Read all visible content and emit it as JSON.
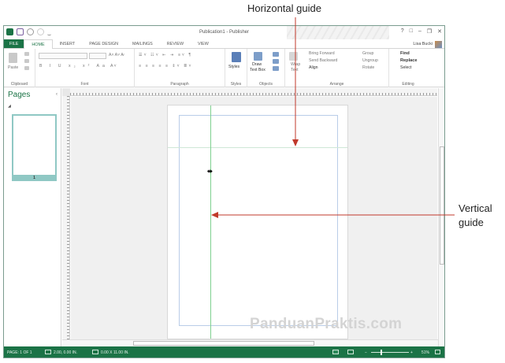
{
  "callouts": {
    "horizontal": "Horizontal guide",
    "vertical_line1": "Vertical",
    "vertical_line2": "guide"
  },
  "watermark": "PanduanPraktis.com",
  "titlebar": {
    "title": "Publication1 - Publisher",
    "help": "?",
    "restore": "□",
    "minimize": "–",
    "close": "✕"
  },
  "tabs": [
    "FILE",
    "HOME",
    "INSERT",
    "PAGE DESIGN",
    "MAILINGS",
    "REVIEW",
    "VIEW"
  ],
  "active_tab": "HOME",
  "user": {
    "name": "Lisa Bucki"
  },
  "ribbon": {
    "clipboard": {
      "label": "Clipboard",
      "paste": "Paste"
    },
    "font": {
      "label": "Font"
    },
    "paragraph": {
      "label": "Paragraph"
    },
    "styles": {
      "label": "Styles",
      "button": "Styles"
    },
    "objects": {
      "label": "Objects",
      "draw_text_box_1": "Draw",
      "draw_text_box_2": "Text Box"
    },
    "arrange": {
      "label": "Arrange",
      "wrap_text_1": "Wrap",
      "wrap_text_2": "Text",
      "bring_forward": "Bring Forward",
      "send_backward": "Send Backward",
      "align": "Align",
      "group": "Group",
      "ungroup": "Ungroup",
      "rotate": "Rotate"
    },
    "editing": {
      "label": "Editing",
      "find": "Find",
      "replace": "Replace",
      "select": "Select"
    }
  },
  "pages_panel": {
    "title": "Pages",
    "thumbnail_number": "1"
  },
  "status_bar": {
    "page": "PAGE: 1 OF 1",
    "position": "2.00, 0.00 IN.",
    "size": "0.00 X 11.00 IN.",
    "zoom": "51%"
  },
  "colors": {
    "accent": "#1b7346",
    "guide_vertical": "#7fd18f",
    "thumb_border": "#8fc8c4"
  }
}
